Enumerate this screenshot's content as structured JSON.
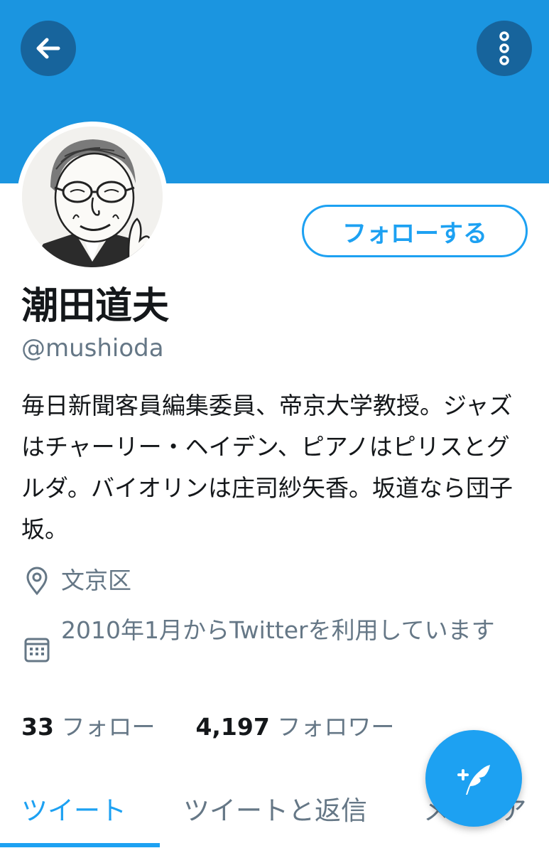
{
  "header": {
    "back_icon": "arrow-left-icon",
    "more_icon": "more-vertical-icon",
    "banner_color": "#1b95e0"
  },
  "profile": {
    "follow_button_label": "フォローする",
    "display_name": "潮田道夫",
    "handle": "@mushioda",
    "bio": "毎日新聞客員編集委員、帝京大学教授。ジャズはチャーリー・ヘイデン、ピアノはピリスとグルダ。バイオリンは庄司紗矢香。坂道なら団子坂。",
    "location": "文京区",
    "joined": "2010年1月からTwitterを利用しています",
    "location_icon": "location-pin-icon",
    "calendar_icon": "calendar-icon"
  },
  "stats": {
    "following_count": "33",
    "following_label": "フォロー",
    "followers_count": "4,197",
    "followers_label": "フォロワー"
  },
  "tabs": [
    {
      "label": "ツイート",
      "active": true
    },
    {
      "label": "ツイートと返信",
      "active": false
    },
    {
      "label": "メディア",
      "active": false
    }
  ],
  "fab": {
    "icon": "compose-tweet-icon"
  },
  "colors": {
    "accent": "#1da1f2",
    "secondary_text": "#657786",
    "primary_text": "#14171a"
  }
}
